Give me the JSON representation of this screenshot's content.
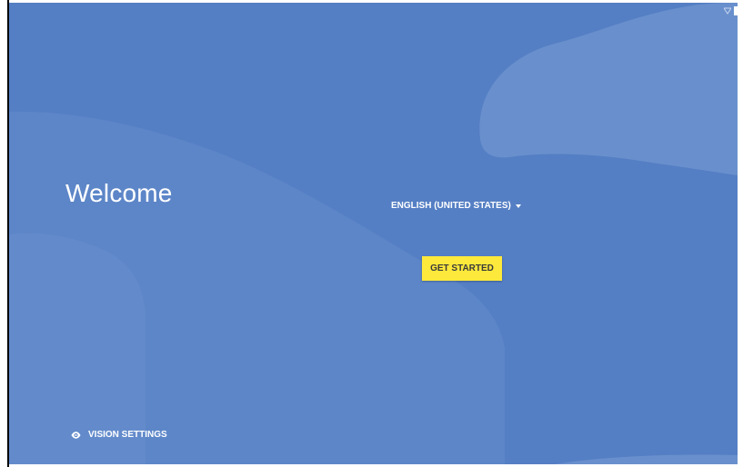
{
  "welcome": {
    "title": "Welcome"
  },
  "language": {
    "selected": "ENGLISH (UNITED STATES)",
    "icon": "caret-down-icon"
  },
  "actions": {
    "get_started_label": "GET STARTED"
  },
  "accessibility": {
    "vision_settings_label": "VISION SETTINGS",
    "icon": "eye-icon"
  },
  "colors": {
    "background": "#557fc4",
    "accent_button": "#fde93b",
    "text": "#ffffff"
  }
}
